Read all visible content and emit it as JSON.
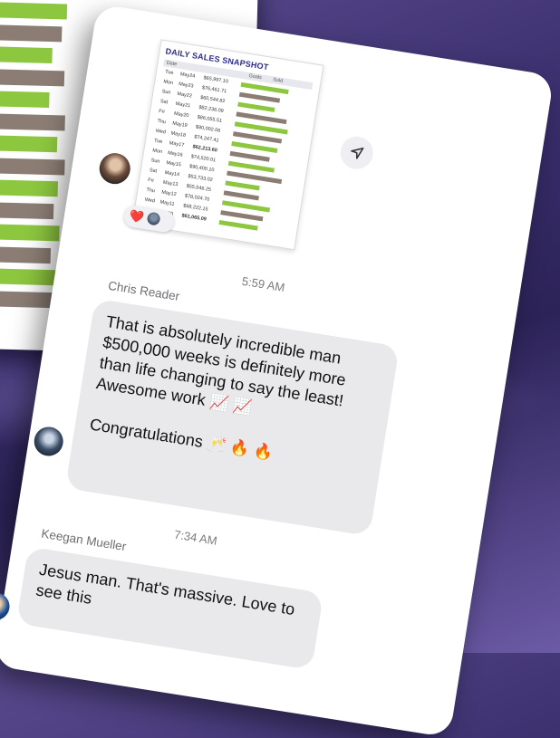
{
  "chat": {
    "attachment": {
      "title": "DAILY SALES SNAPSHOT",
      "head": {
        "date": "Date",
        "goals": "Goals",
        "sold": "Sold"
      },
      "rows": [
        {
          "day": "Tue",
          "date": "May24",
          "amount": "$65,997.10",
          "bar": 0.7,
          "color": "#8dc63f"
        },
        {
          "day": "Mon",
          "date": "May23",
          "amount": "$76,461.71",
          "bar": 0.6,
          "color": "#8b7d74"
        },
        {
          "day": "Sun",
          "date": "May22",
          "amount": "$60,544.82",
          "bar": 0.55,
          "color": "#8dc63f"
        },
        {
          "day": "Sat",
          "date": "May21",
          "amount": "$82,236.09",
          "bar": 0.75,
          "color": "#8b7d74"
        },
        {
          "day": "Fri",
          "date": "May20",
          "amount": "$86,055.51",
          "bar": 0.78,
          "color": "#8dc63f"
        },
        {
          "day": "Thu",
          "date": "May19",
          "amount": "$80,002.06",
          "bar": 0.72,
          "color": "#8b7d74"
        },
        {
          "day": "Wed",
          "date": "May18",
          "amount": "$74,247.41",
          "bar": 0.68,
          "color": "#8dc63f"
        },
        {
          "day": "Tue",
          "date": "May17",
          "amount": "$62,213.60",
          "bar": 0.58,
          "color": "#8b7d74"
        },
        {
          "day": "Mon",
          "date": "May16",
          "amount": "$74,520.01",
          "bar": 0.68,
          "color": "#8dc63f"
        },
        {
          "day": "Sun",
          "date": "May15",
          "amount": "$90,400.10",
          "bar": 0.82,
          "color": "#8b7d74"
        },
        {
          "day": "Sat",
          "date": "May14",
          "amount": "$53,733.02",
          "bar": 0.5,
          "color": "#8dc63f"
        },
        {
          "day": "Fri",
          "date": "May13",
          "amount": "$55,546.25",
          "bar": 0.52,
          "color": "#8b7d74"
        },
        {
          "day": "Thu",
          "date": "May12",
          "amount": "$78,024.70",
          "bar": 0.7,
          "color": "#8dc63f"
        },
        {
          "day": "Wed",
          "date": "May11",
          "amount": "$68,222.15",
          "bar": 0.63,
          "color": "#8b7d74"
        },
        {
          "day": "Tue",
          "date": "May10",
          "amount": "$61,065.09",
          "bar": 0.57,
          "color": "#8dc63f"
        }
      ]
    },
    "reactions": "❤️",
    "messages": [
      {
        "time": "5:59 AM",
        "sender": "Chris Reader",
        "line1": "That is absolutely incredible man $500,000 weeks is definitely more than life changing to say the least! Awesome work",
        "line1_emoji": "📈 📈",
        "line2": "Congratulations",
        "line2_emoji": "🥂 🔥 🔥"
      },
      {
        "time": "7:34 AM",
        "sender": "Keegan Mueller",
        "text": "Jesus man. That's massive. Love to see this"
      }
    ]
  },
  "background_card": {
    "bars": [
      {
        "fraction": 0.95,
        "color": "#8dc63f"
      },
      {
        "fraction": 0.9,
        "color": "#8b7d74"
      },
      {
        "fraction": 0.8,
        "color": "#8dc63f"
      },
      {
        "fraction": 0.94,
        "color": "#8b7d74"
      },
      {
        "fraction": 0.78,
        "color": "#8dc63f"
      },
      {
        "fraction": 0.96,
        "color": "#8b7d74"
      },
      {
        "fraction": 0.88,
        "color": "#8dc63f"
      },
      {
        "fraction": 0.97,
        "color": "#8b7d74"
      },
      {
        "fraction": 0.9,
        "color": "#8dc63f"
      },
      {
        "fraction": 0.86,
        "color": "#8b7d74"
      },
      {
        "fraction": 0.93,
        "color": "#8dc63f"
      },
      {
        "fraction": 0.84,
        "color": "#8b7d74"
      },
      {
        "fraction": 0.9,
        "color": "#8dc63f"
      },
      {
        "fraction": 0.87,
        "color": "#8b7d74"
      }
    ]
  },
  "colors": {
    "bubble": "#e9e9eb",
    "accent_green": "#8dc63f",
    "accent_brown": "#8b7d74"
  }
}
